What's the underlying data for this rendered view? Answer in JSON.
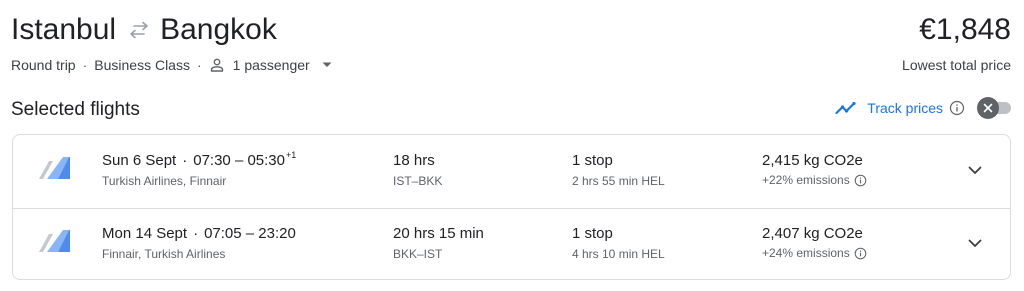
{
  "header": {
    "origin": "Istanbul",
    "destination": "Bangkok",
    "swap_icon": "swap-arrows-icon",
    "price": "€1,848",
    "price_caption": "Lowest total price"
  },
  "trip_options": {
    "trip_type": "Round trip",
    "cabin_class": "Business Class",
    "passengers": "1 passenger",
    "separator": "·",
    "passenger_icon": "person-icon",
    "dropdown_icon": "caret-down-icon"
  },
  "section": {
    "title": "Selected flights"
  },
  "track_prices": {
    "label": "Track prices",
    "icon": "trending-icon",
    "info_icon": "info-icon",
    "toggle_on": false,
    "accent_color": "#1a73e8"
  },
  "flights": [
    {
      "date": "Sun 6 Sept",
      "times": "07:30 – 05:30",
      "day_offset": "+1",
      "airlines": "Turkish Airlines, Finnair",
      "duration": "18 hrs",
      "route": "IST–BKK",
      "stops": "1 stop",
      "layover": "2 hrs 55 min HEL",
      "emissions": "2,415 kg CO2e",
      "emissions_delta": "+22% emissions"
    },
    {
      "date": "Mon 14 Sept",
      "times": "07:05 – 23:20",
      "day_offset": "",
      "airlines": "Finnair, Turkish Airlines",
      "duration": "20 hrs 15 min",
      "route": "BKK–IST",
      "stops": "1 stop",
      "layover": "4 hrs 10 min HEL",
      "emissions": "2,407 kg CO2e",
      "emissions_delta": "+24% emissions"
    }
  ],
  "separator_dot": "·"
}
